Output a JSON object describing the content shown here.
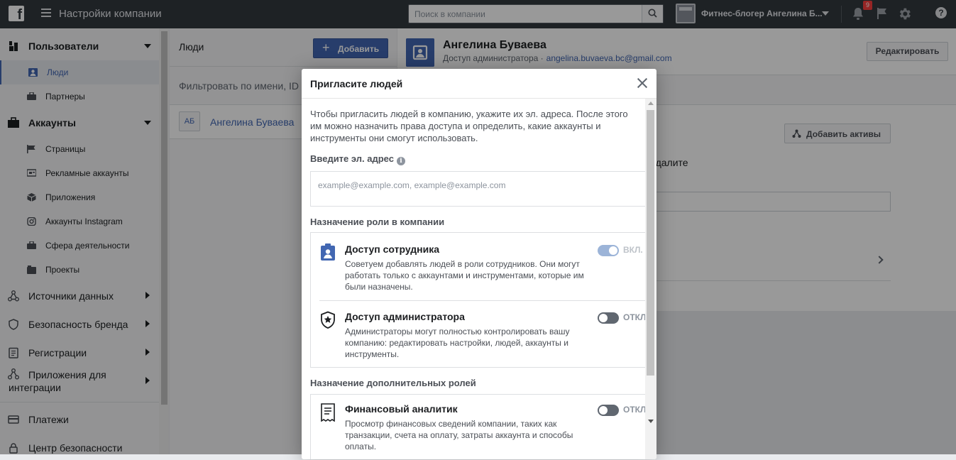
{
  "topbar": {
    "logo": "f",
    "title": "Настройки компании",
    "search_placeholder": "Поиск в компании",
    "business_name": "Фитнес-блогер Ангелина Б...",
    "notifications_count": "9",
    "help": "?"
  },
  "sidebar": {
    "sections": [
      {
        "label": "Пользователи",
        "icon": "users-icon",
        "expanded": true
      },
      {
        "label": "Аккаунты",
        "icon": "briefcase-icon",
        "expanded": true
      },
      {
        "label": "Источники данных",
        "icon": "data-sources-icon"
      },
      {
        "label": "Безопасность бренда",
        "icon": "shield-icon"
      },
      {
        "label": "Регистрации",
        "icon": "registrations-icon"
      },
      {
        "label": "Приложения для интеграции",
        "icon": "integrations-icon"
      },
      {
        "label": "Платежи",
        "icon": "payments-icon"
      },
      {
        "label": "Центр безопасности",
        "icon": "security-center-icon"
      }
    ],
    "users_items": [
      {
        "label": "Люди",
        "icon": "person-icon",
        "active": true
      },
      {
        "label": "Партнеры",
        "icon": "partners-icon"
      }
    ],
    "accounts_items": [
      {
        "label": "Страницы",
        "icon": "flag-icon"
      },
      {
        "label": "Рекламные аккаунты",
        "icon": "ad-account-icon"
      },
      {
        "label": "Приложения",
        "icon": "cube-icon"
      },
      {
        "label": "Аккаунты Instagram",
        "icon": "instagram-icon"
      },
      {
        "label": "Сфера деятельности",
        "icon": "briefcase-icon"
      },
      {
        "label": "Проекты",
        "icon": "projects-icon"
      }
    ]
  },
  "people": {
    "title": "Люди",
    "add_label": "Добавить",
    "filter_placeholder": "Фильтровать по имени, ID",
    "list": [
      {
        "initials": "АБ",
        "name": "Ангелина Буваева"
      }
    ]
  },
  "detail": {
    "name": "Ангелина Буваева",
    "role": "Доступ администратора ·",
    "email": "angelina.buvaeva.bc@gmail.com",
    "edit_label": "Редактировать",
    "add_assets_label": "Добавить активы",
    "description": "зователя Ангелина Буваева. Посмотрите и вьте или удалите активы."
  },
  "modal": {
    "title": "Пригласите людей",
    "intro": "Чтобы пригласить людей в компанию, укажите их эл. адреса. После этого им можно назначить права доступа и определить, какие аккаунты и инструменты они смогут использовать.",
    "email_label": "Введите эл. адрес",
    "email_placeholder": "example@example.com, example@example.com",
    "company_role_heading": "Назначение роли в компании",
    "roles": [
      {
        "name": "Доступ сотрудника",
        "icon": "employee-badge-icon",
        "description": "Советуем добавлять людей в роли сотрудников. Они могут работать только с аккаунтами и инструментами, которые им были назначены.",
        "toggle": "ВКЛ.",
        "enabled": true
      },
      {
        "name": "Доступ администратора",
        "icon": "admin-shield-icon",
        "description": "Администраторы могут полностью контролировать вашу компанию: редактировать настройки, людей, аккаунты и инструменты.",
        "toggle": "ОТКЛ.",
        "enabled": false
      }
    ],
    "additional_roles_heading": "Назначение дополнительных ролей",
    "additional_roles": [
      {
        "name": "Финансовый аналитик",
        "icon": "finance-receipt-icon",
        "description": "Просмотр финансовых сведений компании, таких как транзакции, счета на оплату, затраты аккаунта и способы оплаты.",
        "toggle": "ОТКЛ.",
        "enabled": false
      }
    ]
  },
  "colors": {
    "topbar": "#33393f",
    "accent": "#4267b2",
    "sidebar": "#f5f6f7"
  }
}
